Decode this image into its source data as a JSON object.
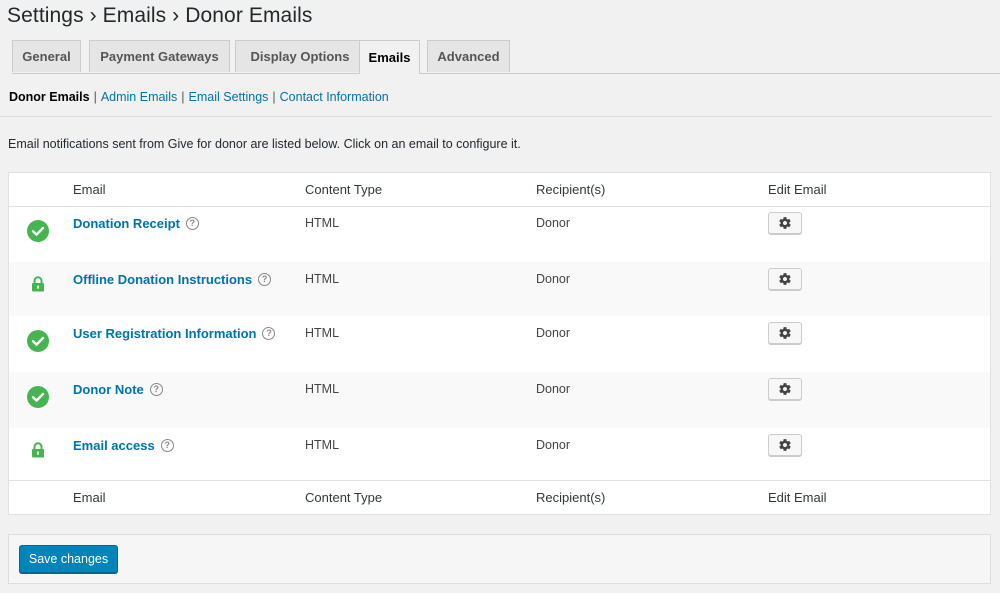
{
  "breadcrumb": "Settings › Emails › Donor Emails",
  "tabs": [
    {
      "label": "General"
    },
    {
      "label": "Payment Gateways"
    },
    {
      "label": "Display Options"
    },
    {
      "label": "Emails"
    },
    {
      "label": "Advanced"
    }
  ],
  "active_tab": "Emails",
  "subnav": {
    "current": "Donor Emails",
    "links": [
      "Admin Emails",
      "Email Settings",
      "Contact Information"
    ]
  },
  "description": "Email notifications sent from Give for donor are listed below. Click on an email to configure it.",
  "table": {
    "headers": [
      "Email",
      "Content Type",
      "Recipient(s)",
      "Edit Email"
    ],
    "rows": [
      {
        "status": "enabled-check-icon",
        "name": "Donation Receipt",
        "content_type": "HTML",
        "recipient": "Donor"
      },
      {
        "status": "locked-icon",
        "name": "Offline Donation Instructions",
        "content_type": "HTML",
        "recipient": "Donor"
      },
      {
        "status": "enabled-check-icon",
        "name": "User Registration Information",
        "content_type": "HTML",
        "recipient": "Donor"
      },
      {
        "status": "enabled-check-icon",
        "name": "Donor Note",
        "content_type": "HTML",
        "recipient": "Donor"
      },
      {
        "status": "locked-icon",
        "name": "Email access",
        "content_type": "HTML",
        "recipient": "Donor"
      }
    ],
    "help_glyph": "?"
  },
  "save_label": "Save changes",
  "colors": {
    "link": "#0073aa",
    "check": "#46b450",
    "lock": "#46b450",
    "primary_button": "#0085ba"
  }
}
